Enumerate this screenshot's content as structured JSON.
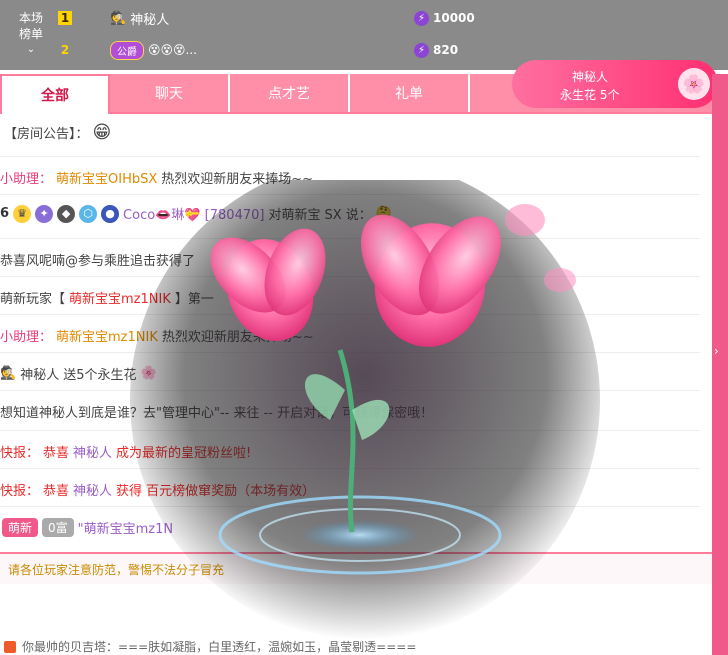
{
  "leaderboard": {
    "label_line1": "本场",
    "label_line2": "榜单",
    "rows": [
      {
        "rank": "1",
        "name": "神秘人",
        "score": "10000"
      },
      {
        "rank": "2",
        "name": "😵😵😵...",
        "badge": "公爵",
        "score": "820"
      }
    ]
  },
  "tabs": [
    "全部",
    "聊天",
    "点才艺",
    "礼单"
  ],
  "gift_badge": {
    "line1": "神秘人",
    "line2": "永生花 5个"
  },
  "chat": [
    {
      "text": "【房间公告】："
    },
    {
      "prefix": "小助理：",
      "name": "萌新宝宝OIHbSX",
      "text": "热烈欢迎新朋友来捧场~~"
    },
    {
      "level": "6",
      "name": "Coco👄琳💝 [780470]",
      "text": "对萌新宝",
      "suffix": "SX 说："
    },
    {
      "text": "恭喜风呢喃@参与乘胜追击获得了"
    },
    {
      "prefix": "萌新玩家【",
      "name": "萌新宝宝mz1NIK",
      "text": "】第一"
    },
    {
      "prefix": "小助理：",
      "name": "萌新宝宝mz1NIK",
      "text": "热烈欢迎新朋友来捧场~~"
    },
    {
      "name": "神秘人",
      "text": "送5个永生花"
    },
    {
      "text": "想知道神秘人到底是谁？去\"管理中心\"-- 来往 -- 开启对话，可获得保密哦！"
    },
    {
      "prefix": "快报：",
      "red": "恭喜",
      "name": "神秘人",
      "text": "成为最新的皇冠粉丝啦!"
    },
    {
      "prefix": "快报：",
      "red": "恭喜",
      "name": "神秘人",
      "text": "获得",
      "suffix": "百元榜做窜奖励（本场有效）"
    },
    {
      "tag1": "萌新",
      "tag2": "0富",
      "text": "\"萌新宝宝mz1N"
    }
  ],
  "notice": "请各位玩家注意防范，警惕不法分子冒充",
  "bottom": "你最帅的贝吉塔：===肤如凝脂，白里透红，温婉如玉，晶莹剔透===="
}
